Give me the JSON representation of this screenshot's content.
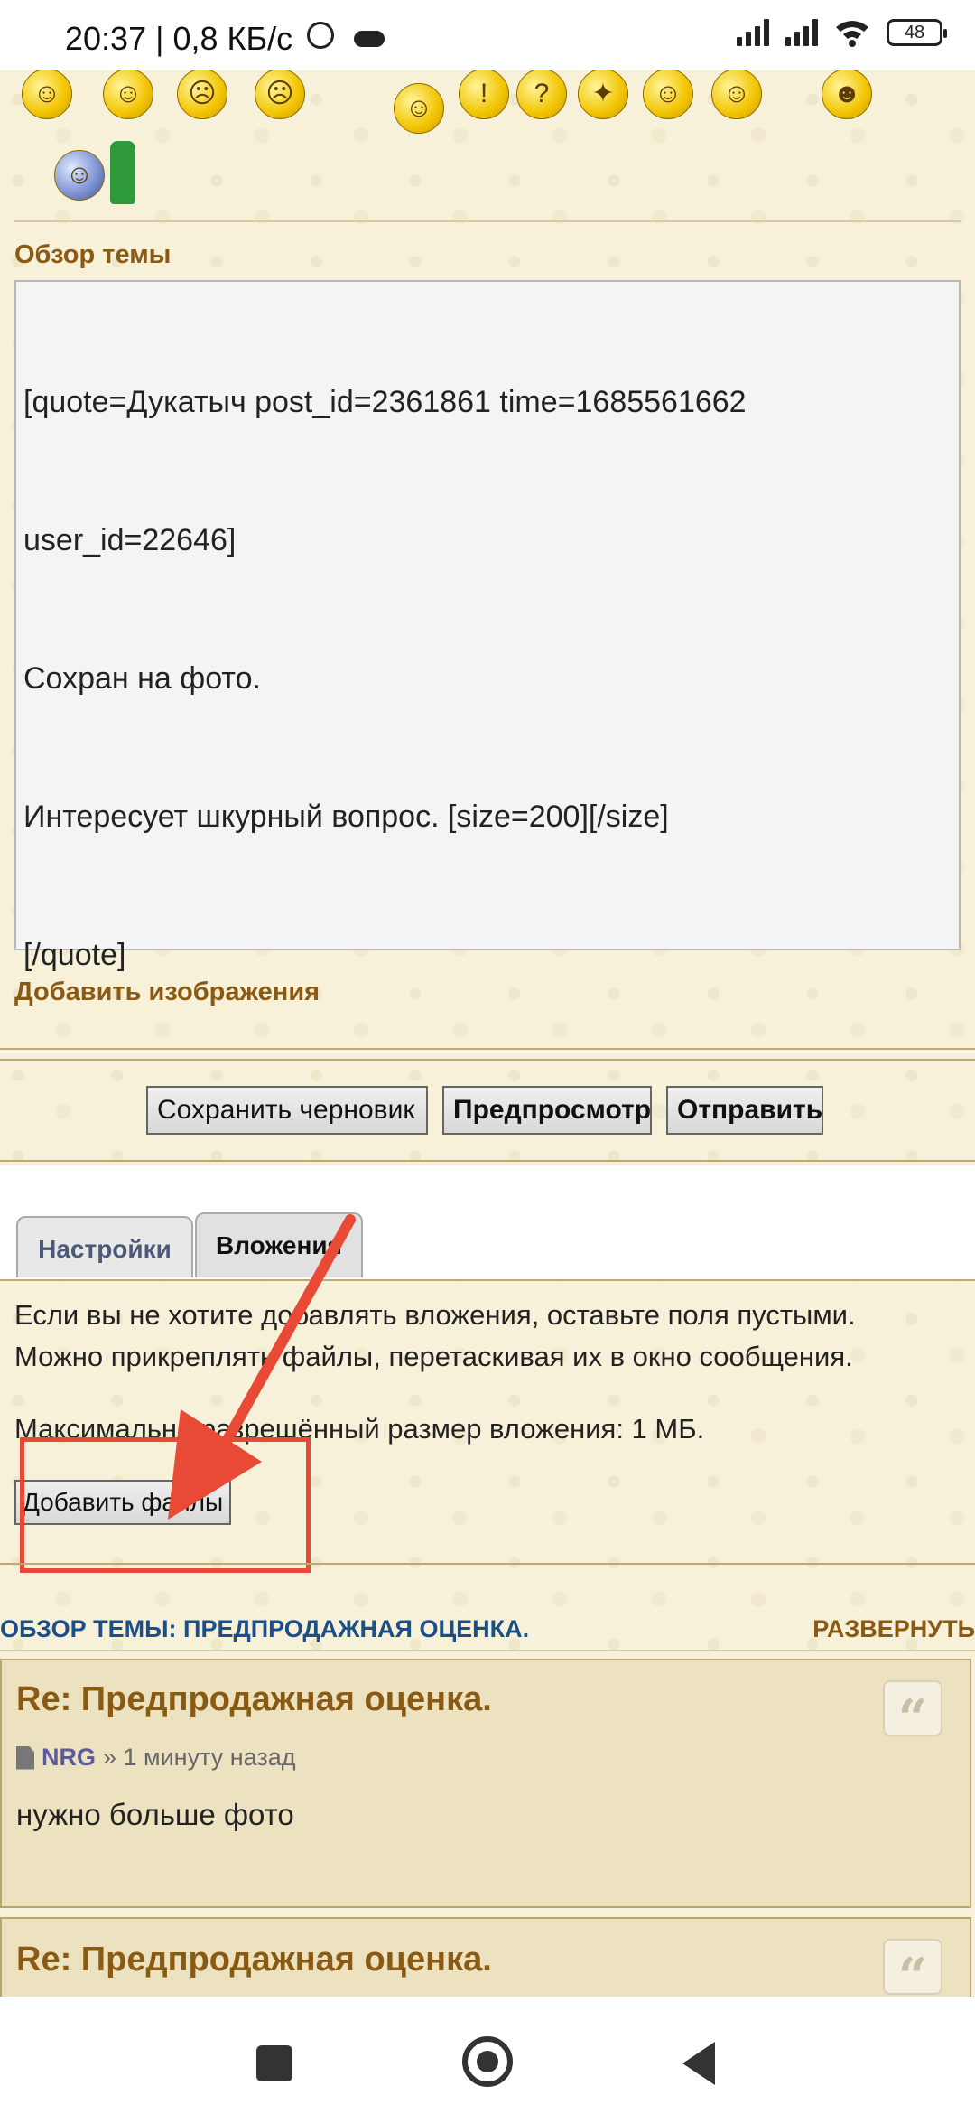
{
  "status_bar": {
    "time_speed": "20:37 | 0,8 КБ/с",
    "alarm_icon": "alarm-clock-icon",
    "cloud_icon": "cloud-icon",
    "battery": "48"
  },
  "editor": {
    "section_label": "Обзор темы",
    "lines": [
      "[quote=Дукатыч post_id=2361861 time=1685561662",
      "user_id=22646]",
      "Сохран на фото.",
      "Интересует шкурный вопрос. [size=200][/size]",
      "[/quote]"
    ],
    "add_images_label": "Добавить изображения"
  },
  "toolbar": {
    "save_draft": "Сохранить черновик",
    "preview": "Предпросмотр",
    "submit": "Отправить"
  },
  "tabs": [
    {
      "label": "Настройки",
      "active": false
    },
    {
      "label": "Вложения",
      "active": true
    }
  ],
  "attachments": {
    "line1": "Если вы не хотите добавлять вложения, оставьте поля пустыми.",
    "line2": "Можно прикреплять файлы, перетаскивая их в окно сообщения.",
    "max_size": "Максимально разрешённый размер вложения: 1 МБ.",
    "add_files": "Добавить файлы"
  },
  "review": {
    "title": "ОБЗОР ТЕМЫ: ПРЕДПРОДАЖНАЯ ОЦЕНКА.",
    "expand": "РАЗВЕРНУТЬ",
    "posts": [
      {
        "title": "Re: Предпродажная оценка.",
        "author": "NRG",
        "time": "» 1 минуту назад",
        "body": "нужно больше фото"
      },
      {
        "title": "Re: Предпродажная оценка."
      }
    ]
  },
  "colors": {
    "background": "#f7f1da",
    "heading_brown": "#8b5a12",
    "link_blue": "#1b4f8a",
    "annotation_red": "#e84a36"
  }
}
